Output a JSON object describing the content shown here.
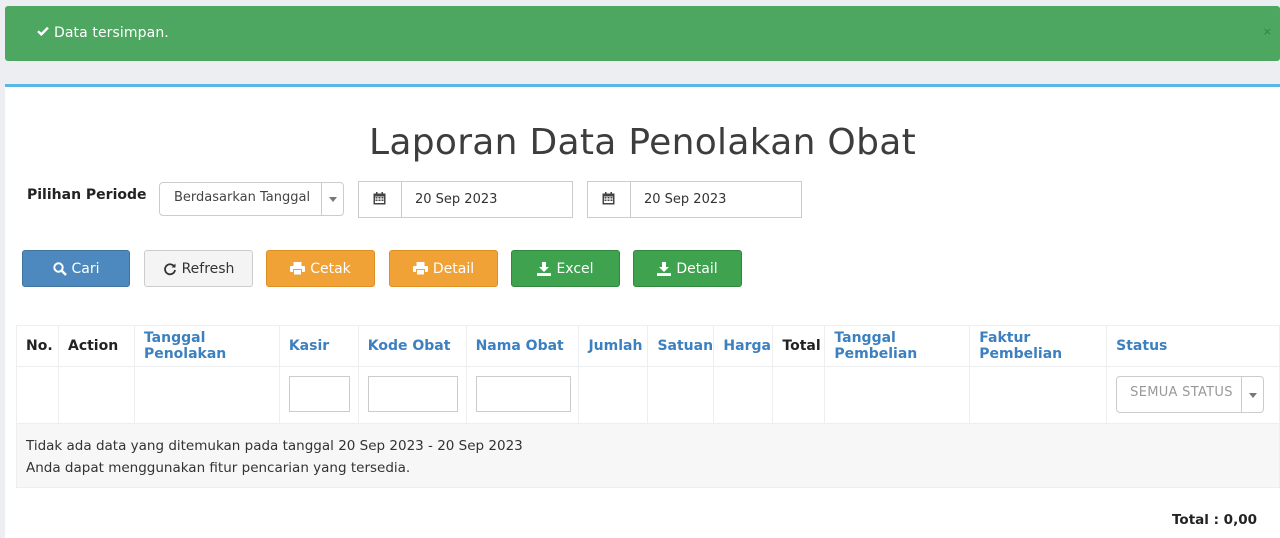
{
  "alert": {
    "message": "Data tersimpan.",
    "close": "×",
    "color": "#4ea761"
  },
  "page": {
    "title": "Laporan Data Penolakan Obat"
  },
  "filters": {
    "period_label": "Pilihan Periode",
    "period_select": "Berdasarkan Tanggal",
    "date_from": "20 Sep 2023",
    "date_to": "20 Sep 2023"
  },
  "buttons": {
    "search": "Cari",
    "refresh": "Refresh",
    "print": "Cetak",
    "print_detail": "Detail",
    "excel": "Excel",
    "excel_detail": "Detail"
  },
  "table": {
    "columns": [
      "No.",
      "Action",
      "Tanggal Penolakan",
      "Kasir",
      "Kode Obat",
      "Nama Obat",
      "Jumlah",
      "Satuan",
      "Harga",
      "Total",
      "Tanggal Pembelian",
      "Faktur Pembelian",
      "Status"
    ],
    "status_filter": "SEMUA STATUS",
    "empty_line1": "Tidak ada data yang ditemukan pada tanggal 20 Sep 2023 - 20 Sep 2023",
    "empty_line2": "Anda dapat menggunakan fitur pencarian yang tersedia."
  },
  "footer": {
    "total": "Total : 0,00"
  },
  "colors": {
    "accent": "#5ab6e5",
    "primary": "#4d88be",
    "warning": "#f0a236",
    "success": "#3fa24f",
    "link": "#3c80c0"
  }
}
